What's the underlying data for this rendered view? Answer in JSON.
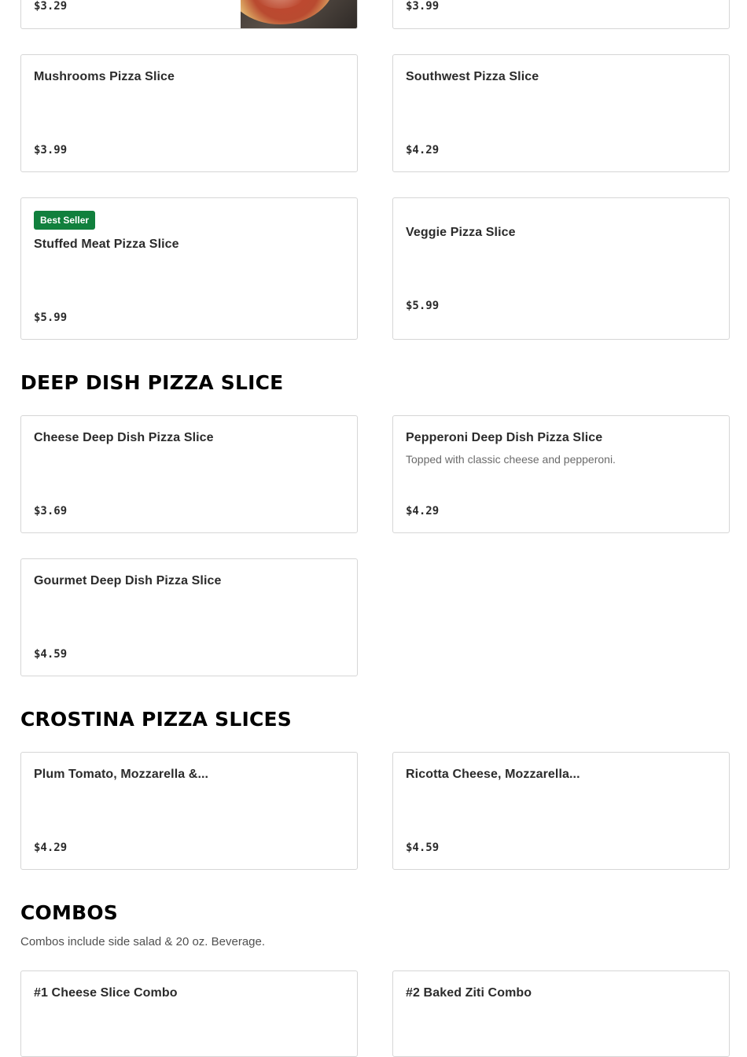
{
  "top_row": [
    {
      "price": "$3.29",
      "has_image": true,
      "image_icon": "pizza-photo"
    },
    {
      "price": "$3.99"
    }
  ],
  "pizza_slices": [
    {
      "name": "Mushrooms Pizza Slice",
      "price": "$3.99"
    },
    {
      "name": "Southwest Pizza Slice",
      "price": "$4.29"
    },
    {
      "badge": "Best Seller",
      "name": "Stuffed Meat Pizza Slice",
      "price": "$5.99"
    },
    {
      "name": "Veggie Pizza Slice",
      "price": "$5.99"
    }
  ],
  "deep_dish": {
    "title": "DEEP DISH PIZZA SLICE",
    "items": [
      {
        "name": "Cheese Deep Dish Pizza Slice",
        "price": "$3.69"
      },
      {
        "name": "Pepperoni Deep Dish Pizza Slice",
        "description": "Topped with classic cheese and pepperoni.",
        "price": "$4.29"
      },
      {
        "name": "Gourmet Deep Dish Pizza Slice",
        "price": "$4.59"
      }
    ]
  },
  "crostina": {
    "title": "CROSTINA PIZZA SLICES",
    "items": [
      {
        "name": "Plum Tomato, Mozzarella &...",
        "price": "$4.29"
      },
      {
        "name": "Ricotta Cheese, Mozzarella...",
        "price": "$4.59"
      }
    ]
  },
  "combos": {
    "title": "COMBOS",
    "note": "Combos include side salad & 20 oz. Beverage.",
    "items": [
      {
        "name": "#1 Cheese Slice Combo"
      },
      {
        "name": "#2 Baked Ziti Combo"
      }
    ]
  },
  "colors": {
    "badge_bg": "#11803d",
    "border": "#d6d6d6",
    "text": "#2b2b2b"
  }
}
